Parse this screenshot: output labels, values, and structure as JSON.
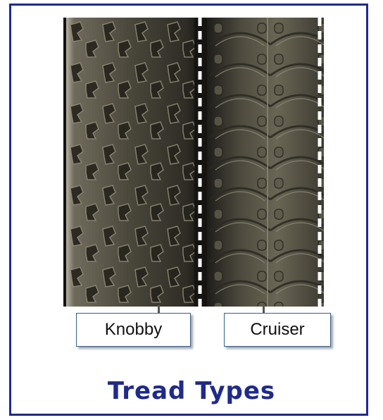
{
  "labels": {
    "left_tire": "Knobby",
    "right_tire": "Cruiser"
  },
  "title": "Tread Types",
  "colors": {
    "frame": "#1f2a8c",
    "title": "#1f2a8c",
    "tread_dark": "#2c2a22",
    "tread_light": "#6d6a58",
    "divider": "#ffffff"
  }
}
